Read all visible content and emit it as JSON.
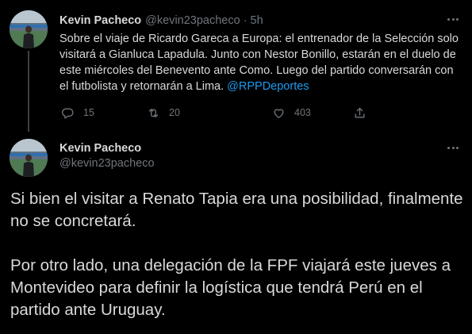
{
  "parent_tweet": {
    "author_name": "Kevin Pacheco",
    "handle": "@kevin23pacheco",
    "separator": "·",
    "time": "5h",
    "text": "Sobre el viaje de Ricardo Gareca a Europa: el entrenador de la Selección solo visitará a Gianluca Lapadula. Junto con Nestor Bonillo, estarán en el duelo de este miércoles del Benevento ante Como. Luego del partido conversarán con el futbolista y retornarán a Lima. ",
    "mention": "@RPPDeportes",
    "actions": {
      "reply_count": "15",
      "retweet_count": "20",
      "like_count": "403"
    }
  },
  "main_tweet": {
    "author_name": "Kevin Pacheco",
    "handle": "@kevin23pacheco",
    "paragraphs": [
      "Si bien el visitar a Renato Tapia era una posibilidad, finalmente no se concretará.",
      "Por otro lado, una delegación de la FPF viajará este jueves a Montevideo para definir la logística que tendrá Perú en el partido ante Uruguay."
    ]
  },
  "icons": {
    "reply": "reply-icon",
    "retweet": "retweet-icon",
    "like": "heart-icon",
    "share": "share-icon",
    "more": "more-options-icon"
  },
  "colors": {
    "background": "#000000",
    "text": "#d9d9d9",
    "muted": "#6e767d",
    "link": "#1d9bf0"
  }
}
